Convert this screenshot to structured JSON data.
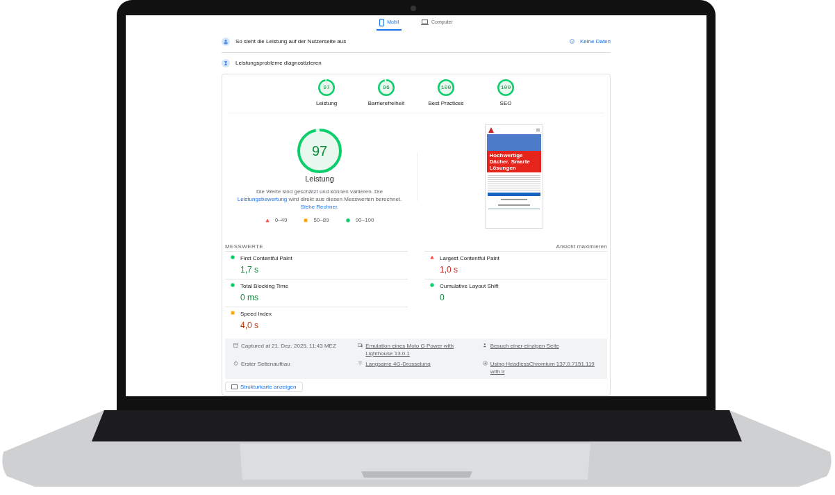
{
  "tabs": [
    {
      "label": "Mobil",
      "selected": true
    },
    {
      "label": "Computer",
      "selected": false
    }
  ],
  "field_data": {
    "title": "So sieht die Leistung auf der Nutzerseite aus",
    "status": "Keine Daten"
  },
  "diagnose": {
    "title": "Leistungsprobleme diagnostizieren"
  },
  "categories": [
    {
      "label": "Leistung",
      "score": "97",
      "level": 0.97
    },
    {
      "label": "Barrierefreiheit",
      "score": "96",
      "level": 0.96
    },
    {
      "label": "Best Practices",
      "score": "100",
      "level": 1
    },
    {
      "label": "SEO",
      "score": "100",
      "level": 1
    }
  ],
  "main_gauge": {
    "score": "97",
    "level": 0.97,
    "label": "Leistung"
  },
  "description": [
    {
      "text": "Die Werte sind geschätzt und können variieren. Die ",
      "link": false
    },
    {
      "text": "Leistungsbewertung",
      "link": true
    },
    {
      "text": " wird direkt aus diesen Messwerten berechnet. ",
      "link": false
    },
    {
      "text": "Siehe Rechner.",
      "link": true
    }
  ],
  "legend": [
    {
      "kind": "poor",
      "range": "0–49"
    },
    {
      "kind": "average",
      "range": "50–89"
    },
    {
      "kind": "good",
      "range": "90–100"
    }
  ],
  "screenshot": {
    "headline": "Hochwertige Dächer. Smarte Lösungen"
  },
  "metrics_header": {
    "title": "MESSWERTE",
    "toggle": "Ansicht maximieren"
  },
  "metrics": [
    {
      "name": "First Contentful Paint",
      "value": "1,7 s",
      "kind": "good"
    },
    {
      "name": "Largest Contentful Paint",
      "value": "1,0 s",
      "kind": "poor"
    },
    {
      "name": "Total Blocking Time",
      "value": "0 ms",
      "kind": "good"
    },
    {
      "name": "Cumulative Layout Shift",
      "value": "0",
      "kind": "good"
    },
    {
      "name": "Speed Index",
      "value": "4,0 s",
      "kind": "average"
    }
  ],
  "run_info": [
    {
      "text": "Captured at 21. Dez. 2025, 11:43 MEZ",
      "link": false
    },
    {
      "text": "Emulation eines Moto G Power with Lighthouse 13.0.1",
      "link": true
    },
    {
      "text": "Besuch einer einzigen Seite",
      "link": true
    },
    {
      "text": "Erster Seitenaufbau",
      "link": false
    },
    {
      "text": "Langsame 4G-Drosselung",
      "link": true
    },
    {
      "text": "Using HeadlessChromium 137.0.7151.119 with lr",
      "link": true
    }
  ],
  "treemap_button": "Strukturkarte anzeigen"
}
